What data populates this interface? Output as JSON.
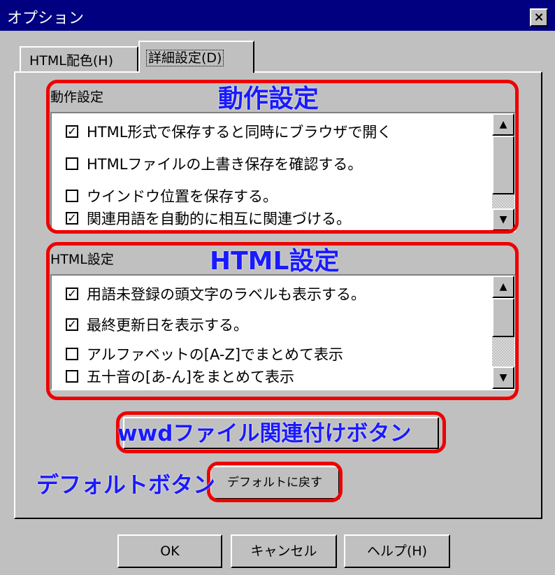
{
  "window": {
    "title": "オプション",
    "close_symbol": "×"
  },
  "tabs": [
    {
      "label": "HTML配色(H)"
    },
    {
      "label": "詳細設定(D)"
    }
  ],
  "behavior": {
    "group_label": "動作設定",
    "items": [
      {
        "label": "HTML形式で保存すると同時にブラウザで開く",
        "checked": true
      },
      {
        "label": "HTMLファイルの上書き保存を確認する。",
        "checked": false
      },
      {
        "label": "ウインドウ位置を保存する。",
        "checked": false
      },
      {
        "label": "関連用語を自動的に相互に関連づける。",
        "checked": true
      }
    ]
  },
  "html_settings": {
    "group_label": "HTML設定",
    "items": [
      {
        "label": "用語未登録の頭文字のラベルも表示する。",
        "checked": true
      },
      {
        "label": "最終更新日を表示する。",
        "checked": true
      },
      {
        "label": "アルファベットの[A-Z]でまとめて表示",
        "checked": false
      },
      {
        "label": "五十音の[あ-ん]をまとめて表示",
        "checked": false
      }
    ]
  },
  "buttons": {
    "default_label": "デフォルトに戻す",
    "ok_label": "OK",
    "cancel_label": "キャンセル",
    "help_label": "ヘルプ(H)"
  },
  "annotations": {
    "behavior": "動作設定",
    "html": "HTML設定",
    "wwd_button": "wwdファイル関連付けボタン",
    "default_button": "デフォルトボタン"
  },
  "check_mark": "✓",
  "scroll_up": "▲",
  "scroll_down": "▼",
  "colors": {
    "titlebar": "#000080",
    "highlight": "#ee0000",
    "annotation": "#1a1aff"
  }
}
